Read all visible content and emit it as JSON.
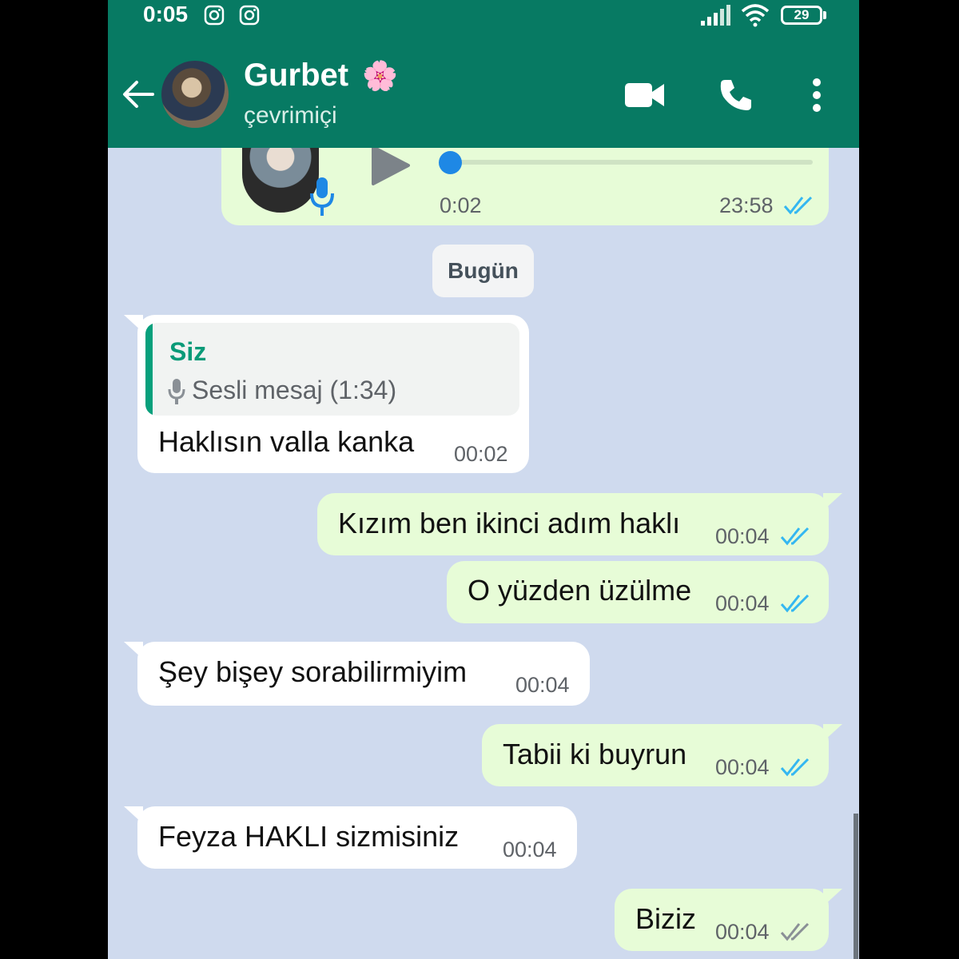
{
  "status_bar": {
    "time": "0:05",
    "battery": "29",
    "icons": [
      "instagram-icon",
      "instagram-icon",
      "signal-icon",
      "wifi-icon",
      "battery-icon"
    ]
  },
  "header": {
    "contact_name": "Gurbet",
    "name_emoji": "🌸",
    "status": "çevrimiçi",
    "icons": [
      "back-arrow-icon",
      "video-call-icon",
      "voice-call-icon",
      "more-options-icon"
    ]
  },
  "colors": {
    "header": "#077a63",
    "chat_bg": "#cfdaee",
    "outgoing": "#e7fcd7",
    "incoming": "#ffffff",
    "read_tick": "#34b7f1"
  },
  "voice_message": {
    "duration": "0:02",
    "time": "23:58",
    "progress": 0.0,
    "icons": [
      "play-icon",
      "mic-icon"
    ]
  },
  "date_chip": "Bugün",
  "messages": [
    {
      "dir": "in",
      "quote_author": "Siz",
      "quote_text": "Sesli mesaj (1:34)",
      "text": "Haklısın valla kanka",
      "time": "00:02"
    },
    {
      "dir": "out",
      "text": "Kızım ben ikinci adım haklı",
      "time": "00:04",
      "status": "read"
    },
    {
      "dir": "out",
      "text": "O yüzden üzülme",
      "time": "00:04",
      "status": "read"
    },
    {
      "dir": "in",
      "text": "Şey bişey sorabilirmiyim",
      "time": "00:04"
    },
    {
      "dir": "out",
      "text": "Tabii ki buyrun",
      "time": "00:04",
      "status": "read"
    },
    {
      "dir": "in",
      "text": "Feyza HAKLI sizmisiniz",
      "time": "00:04"
    },
    {
      "dir": "out",
      "text": "Biziz",
      "time": "00:04",
      "status": "delivered"
    }
  ]
}
